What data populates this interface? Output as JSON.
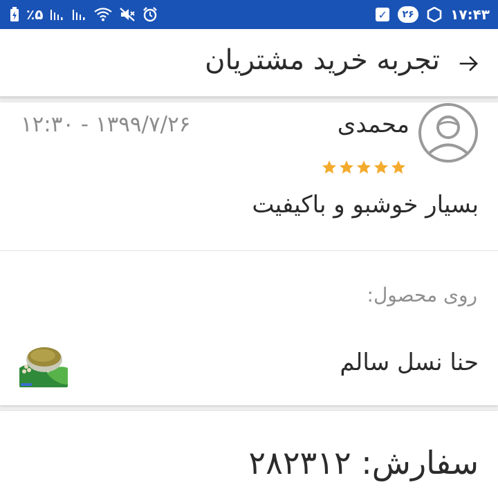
{
  "status_bar": {
    "battery_percent": "٪۵",
    "time": "۱۷:۴۳",
    "notification_count": "۲۶",
    "icons": [
      "battery-charging-icon",
      "signal-icon",
      "signal-icon",
      "wifi-icon",
      "mute-icon",
      "alarm-icon",
      "check-icon",
      "hexagon-icon"
    ]
  },
  "toolbar": {
    "title": "تجربه خرید مشتریان",
    "back_icon": "arrow-right-icon"
  },
  "review": {
    "reviewer_name": "محمدی",
    "date": "۱۳۹۹/۷/۲۶ - ۱۲:۳۰",
    "rating": 5,
    "rating_max": 5,
    "text": "بسیار خوشبو و باکیفیت",
    "product_label": "روی محصول:",
    "product_name": "حنا نسل سالم",
    "avatar_icon": "user-avatar-icon"
  },
  "order": {
    "text": "سفارش: ۲۸۲۳۱۲"
  },
  "colors": {
    "status_bar": "#1a53b6",
    "star": "#f4ab2d",
    "muted_text": "#8c8c8c"
  }
}
